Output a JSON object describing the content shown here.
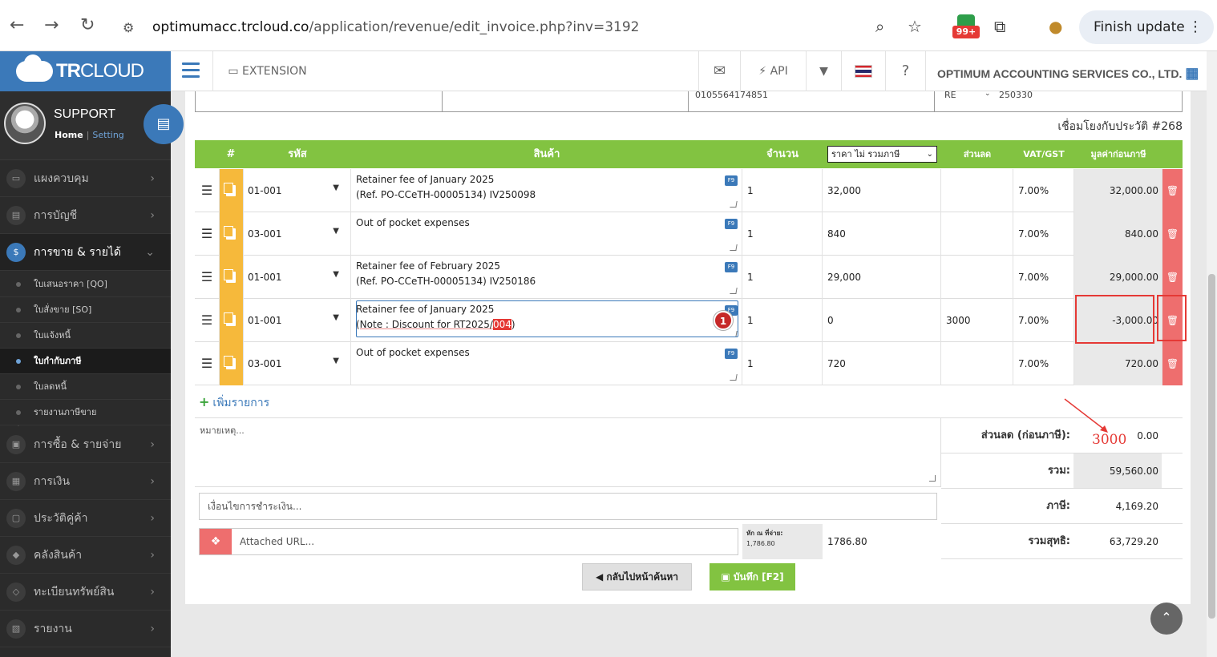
{
  "browser": {
    "url_host": "optimumacc.trcloud.co",
    "url_path": "/application/revenue/edit_invoice.php?inv=3192",
    "ext_badge": "99+",
    "finish_update": "Finish update"
  },
  "brand": {
    "logo_bold": "TR",
    "logo_rest": "CLOUD"
  },
  "topbar": {
    "extension": "EXTENSION",
    "api": "API",
    "company": "OPTIMUM ACCOUNTING SERVICES CO., LTD."
  },
  "profile": {
    "name": "SUPPORT",
    "home": "Home",
    "setting": "Setting"
  },
  "sidebar": {
    "menu": [
      {
        "label": "แผงควบคุม"
      },
      {
        "label": "การบัญชี"
      },
      {
        "label": "การขาย & รายได้"
      },
      {
        "label": "การซื้อ & รายจ่าย"
      },
      {
        "label": "การเงิน"
      },
      {
        "label": "ประวัติคู่ค้า"
      },
      {
        "label": "คลังสินค้า"
      },
      {
        "label": "ทะเบียนทรัพย์สิน"
      },
      {
        "label": "รายงาน"
      }
    ],
    "sub": [
      {
        "label": "ใบเสนอราคา [QO]"
      },
      {
        "label": "ใบสั่งขาย [SO]"
      },
      {
        "label": "ใบแจ้งหนี้"
      },
      {
        "label": "ใบกำกับภาษี"
      },
      {
        "label": "ใบลดหนี้"
      },
      {
        "label": "รายงานภาษีขาย"
      }
    ]
  },
  "prev_row": {
    "tax_id": "0105564174851",
    "prefix": "RE",
    "number": "250330"
  },
  "linked_history": "เชื่อมโยงกับประวัติ #268",
  "table": {
    "headers": {
      "num": "#",
      "code": "รหัส",
      "product": "สินค้า",
      "qty": "จำนวน",
      "price_mode": "ราคา ไม่ รวมภาษี",
      "discount": "ส่วนลด",
      "vat": "VAT/GST",
      "amount": "มูลค่าก่อนภาษี"
    },
    "rows": [
      {
        "code": "01-001",
        "line1": "Retainer fee of January 2025",
        "line2": "(Ref. PO-CCeTH-00005134) IV250098",
        "qty": "1",
        "price": "32,000",
        "discount": "",
        "vat": "7.00%",
        "amount": "32,000.00"
      },
      {
        "code": "03-001",
        "line1": "Out of pocket expenses",
        "line2": "",
        "qty": "1",
        "price": "840",
        "discount": "",
        "vat": "7.00%",
        "amount": "840.00"
      },
      {
        "code": "01-001",
        "line1": "Retainer fee of February 2025",
        "line2": "(Ref. PO-CCeTH-00005134) IV250186",
        "qty": "1",
        "price": "29,000",
        "discount": "",
        "vat": "7.00%",
        "amount": "29,000.00"
      },
      {
        "code": "01-001",
        "line1": "Retainer fee of January 2025",
        "line2_pre": "(Note : Discount for RT2025/",
        "line2_hl": "004",
        "line2_post": ")",
        "qty": "1",
        "price": "0",
        "discount": "3000",
        "vat": "7.00%",
        "amount": "-3,000.00"
      },
      {
        "code": "03-001",
        "line1": "Out of pocket expenses",
        "line2": "",
        "qty": "1",
        "price": "720",
        "discount": "",
        "vat": "7.00%",
        "amount": "720.00"
      }
    ],
    "f9": "F9",
    "error_badge": "1"
  },
  "add_row": "เพิ่มรายการ",
  "footer": {
    "remarks_placeholder": "หมายเหตุ...",
    "payterms_placeholder": "เงื่อนไขการชำระเงิน...",
    "attach_placeholder": "Attached URL...",
    "wht_label": "หัก ณ ที่จ่าย:",
    "wht_sub": "1,786.80",
    "wht_value": "1786.80",
    "discount_label": "ส่วนลด (ก่อนภาษี):",
    "discount_value": "0.00",
    "total_label": "รวม:",
    "total_value": "59,560.00",
    "tax_label": "ภาษี:",
    "tax_value": "4,169.20",
    "net_label": "รวมสุทธิ:",
    "net_value": "63,729.20"
  },
  "buttons": {
    "back": "กลับไปหน้าค้นหา",
    "save": "บันทึก [F2]"
  },
  "annotation": "3000",
  "colors": {
    "brand": "#3b79b9",
    "header_green": "#82c341",
    "delete_red": "#ee6e6e",
    "copy_orange": "#f6b93b",
    "annotation_red": "#e53935"
  }
}
